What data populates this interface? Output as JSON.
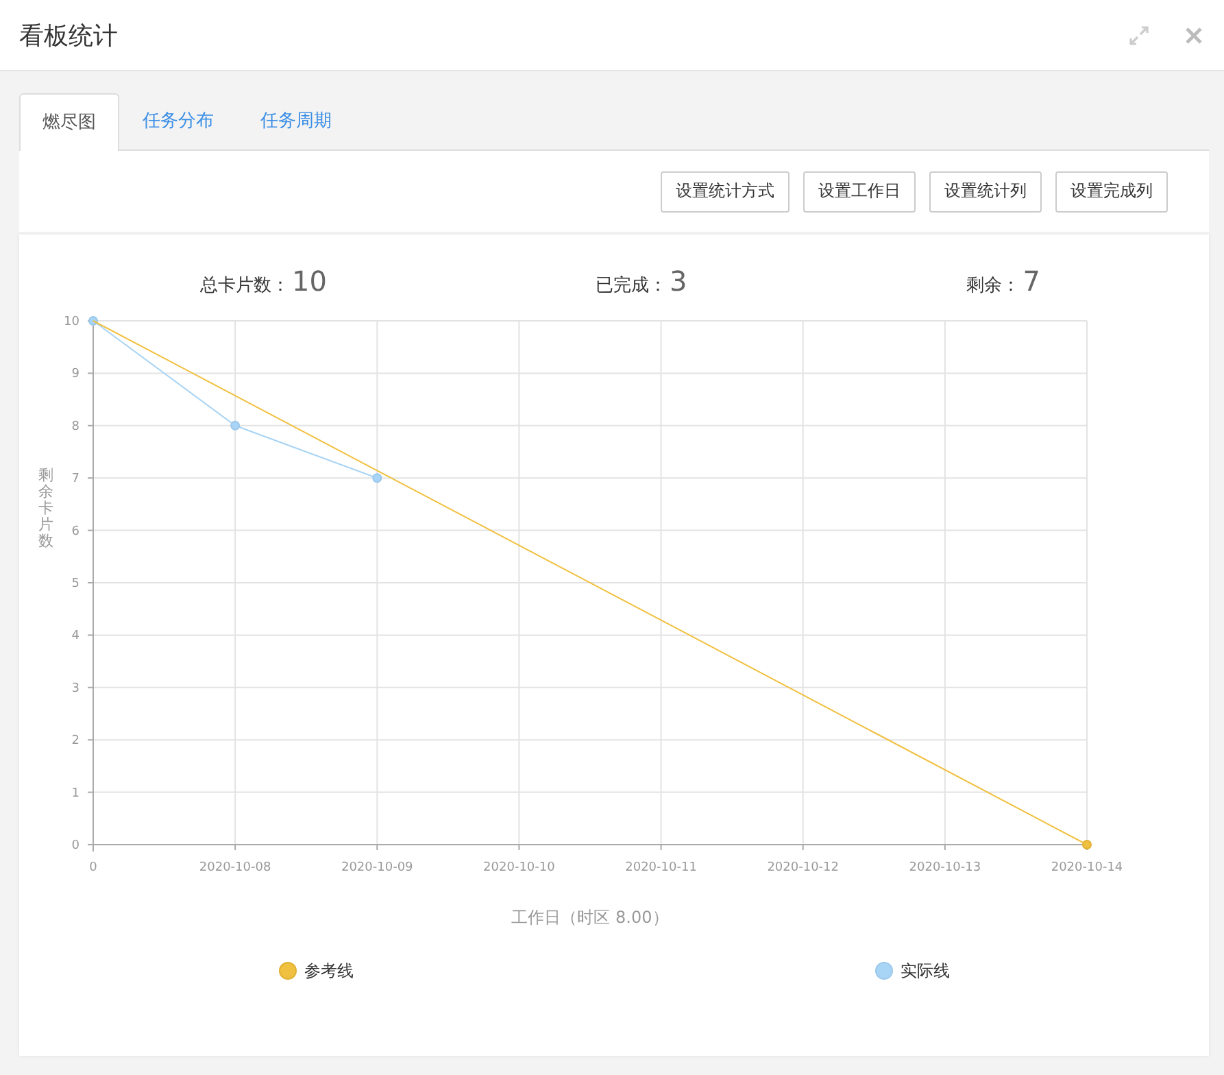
{
  "window": {
    "title": "看板统计"
  },
  "tabs": [
    {
      "label": "燃尽图",
      "selected": true
    },
    {
      "label": "任务分布",
      "selected": false
    },
    {
      "label": "任务周期",
      "selected": false
    }
  ],
  "buttons": [
    "设置统计方式",
    "设置工作日",
    "设置统计列",
    "设置完成列"
  ],
  "stats": [
    {
      "label": "总卡片数：",
      "value": "10"
    },
    {
      "label": "已完成：",
      "value": "3"
    },
    {
      "label": "剩余：",
      "value": "7"
    }
  ],
  "chart_data": {
    "type": "line",
    "xlabel": "工作日（时区 8.00）",
    "ylabel": "剩余卡片数",
    "categories": [
      "0",
      "2020-10-08",
      "2020-10-09",
      "2020-10-10",
      "2020-10-11",
      "2020-10-12",
      "2020-10-13",
      "2020-10-14"
    ],
    "grid": true,
    "legend": true,
    "ylim": [
      0,
      10
    ],
    "yticks": [
      {
        "value": 0,
        "label": "0"
      },
      {
        "value": 1,
        "label": "1"
      },
      {
        "value": 2,
        "label": "2"
      },
      {
        "value": 3,
        "label": "3"
      },
      {
        "value": 4,
        "label": "4"
      },
      {
        "value": 5,
        "label": "5"
      },
      {
        "value": 6,
        "label": "6"
      },
      {
        "value": 7,
        "label": "7"
      },
      {
        "value": 8,
        "label": "8"
      },
      {
        "value": 9,
        "label": "9"
      },
      {
        "value": 10,
        "label": "10"
      }
    ],
    "series": [
      {
        "name": "参考线",
        "marker": "circle",
        "color": "#f0c040",
        "values": [
          10,
          null,
          null,
          null,
          null,
          null,
          null,
          0
        ]
      },
      {
        "name": "实际线",
        "marker": "circle",
        "color": "#a8d4f5",
        "values": [
          10,
          8,
          7,
          null,
          null,
          null,
          null,
          null
        ]
      }
    ]
  }
}
